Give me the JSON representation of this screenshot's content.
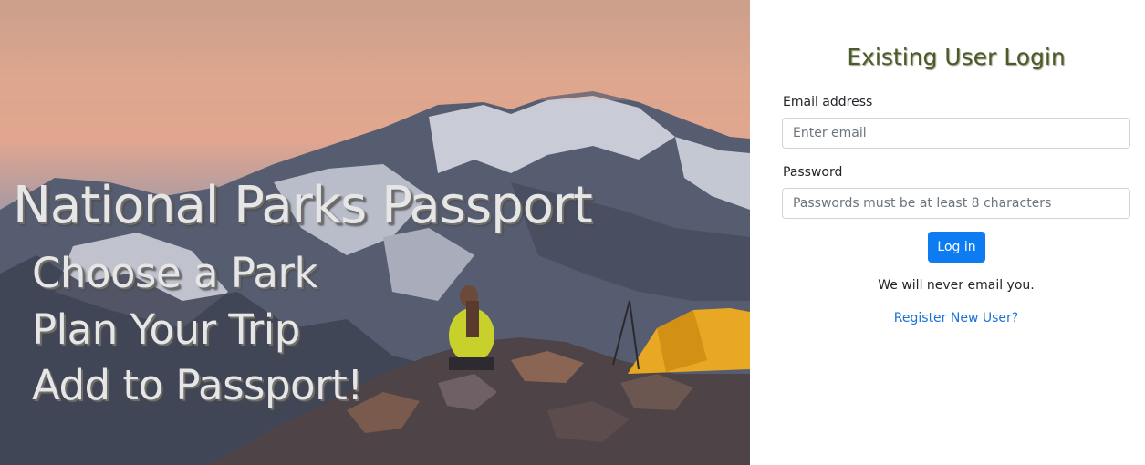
{
  "hero": {
    "title": "National Parks Passport",
    "lines": [
      "Choose a Park",
      "Plan Your Trip",
      "Add to Passport!"
    ]
  },
  "login": {
    "heading": "Existing User Login",
    "email_label": "Email address",
    "email_placeholder": "Enter email",
    "password_label": "Password",
    "password_placeholder": "Passwords must be at least 8 characters",
    "submit_label": "Log in",
    "note": "We will never email you.",
    "register_link": "Register New User?"
  },
  "colors": {
    "heading": "#4c5a2a",
    "button": "#0d7cf2",
    "link": "#1a73d9"
  }
}
